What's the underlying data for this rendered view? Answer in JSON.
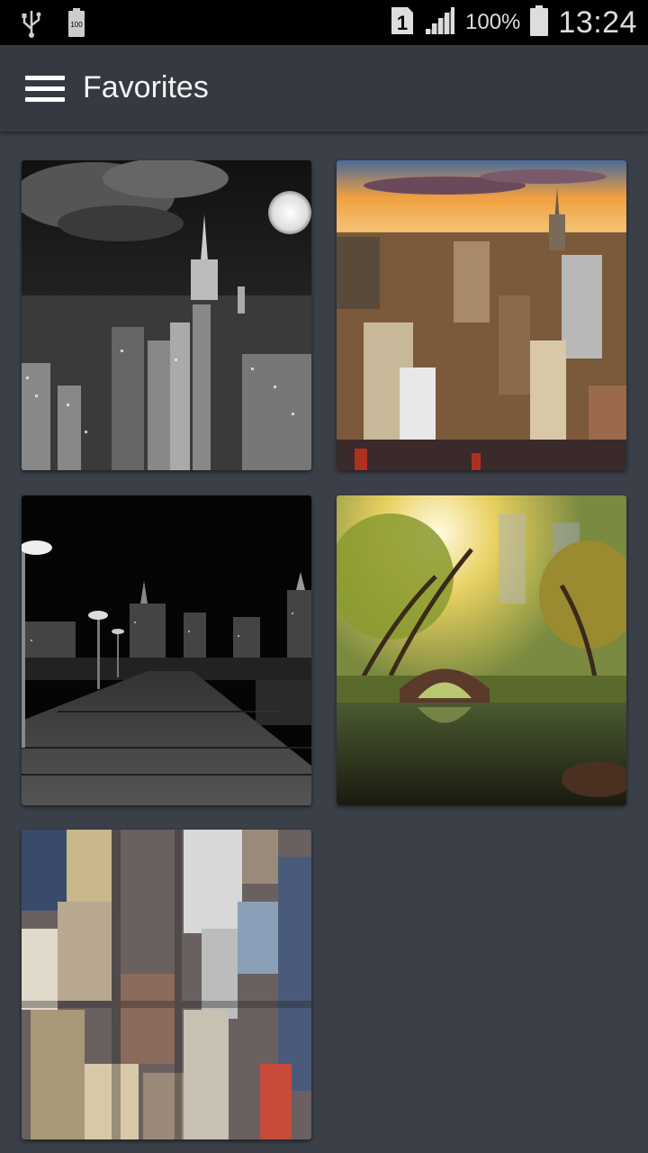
{
  "status_bar": {
    "battery_percent": "100%",
    "time": "13:24",
    "sim_slot": "1",
    "battery_saver_badge": "100",
    "icons": [
      "usb-icon",
      "battery-small-icon",
      "sim-icon",
      "signal-icon",
      "battery-icon"
    ]
  },
  "app_bar": {
    "title": "Favorites",
    "menu_icon": "hamburger-menu-icon"
  },
  "favorites": [
    {
      "subject": "night-city-moon-grayscale"
    },
    {
      "subject": "city-sunset-aerial"
    },
    {
      "subject": "night-pier-grayscale"
    },
    {
      "subject": "park-bridge-autumn"
    },
    {
      "subject": "city-aerial-buildings"
    }
  ]
}
